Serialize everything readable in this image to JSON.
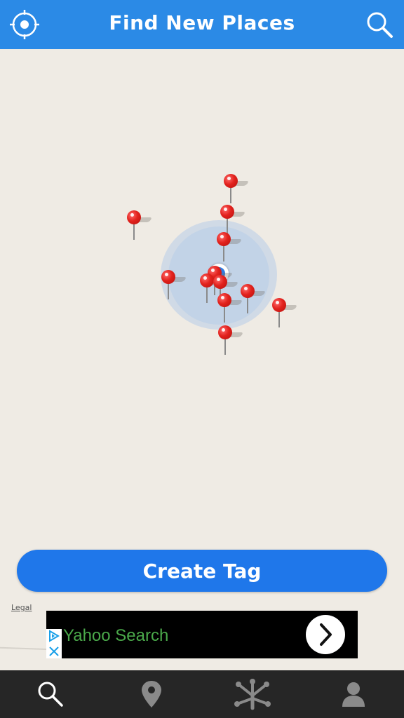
{
  "header": {
    "title": "Find New Places",
    "left_icon": "locate-icon",
    "right_icon": "search-icon"
  },
  "map": {
    "legal_label": "Legal",
    "pin_count": 12
  },
  "actions": {
    "create_label": "Create Tag"
  },
  "ad": {
    "text": "Yahoo Search",
    "icons": [
      "adchoices-icon",
      "close-icon",
      "chevron-right-icon"
    ]
  },
  "tabbar": {
    "tabs": [
      "search-icon",
      "location-pin-icon",
      "frog-foot-icon",
      "profile-icon"
    ]
  },
  "colors": {
    "brand": "#2b8ae6",
    "button": "#1f77ea",
    "pin": "#e2221d",
    "map": "#efebe4",
    "tabbar": "#262626"
  }
}
